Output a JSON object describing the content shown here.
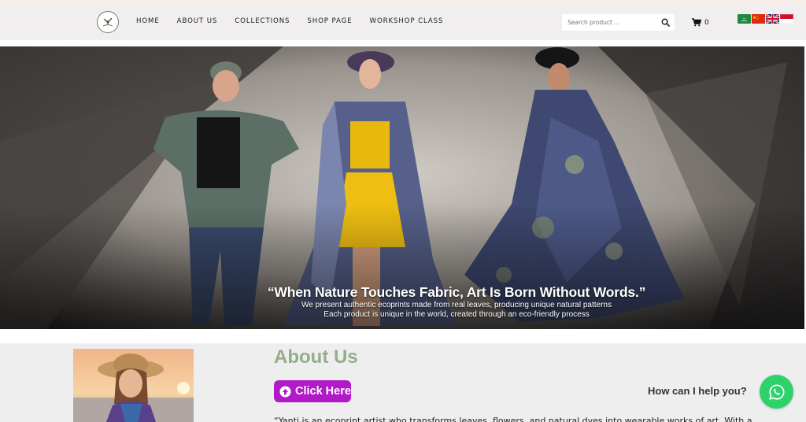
{
  "colors": {
    "nav_bg": "#f0eeee",
    "about_title": "#94ad8e",
    "button_bg": "#b219c8",
    "whatsapp": "#2dd36a"
  },
  "header": {
    "logo_icon": "brand-logo-icon",
    "nav": [
      "HOME",
      "ABOUT US",
      "COLLECTIONS",
      "SHOP PAGE",
      "WORKSHOP CLASS"
    ],
    "search_placeholder": "Search product ...",
    "search_icon": "search-icon",
    "cart_icon": "cart-icon",
    "cart_count": "0",
    "flags": [
      "arabic-flag-icon",
      "chinese-flag-icon",
      "uk-flag-icon",
      "indonesia-flag-icon"
    ]
  },
  "hero": {
    "headline": "“When Nature Touches Fabric, Art Is Born Without Words.”",
    "line1": "We present authentic ecoprints made from real leaves, producing unique natural patterns",
    "line2": "Each product is unique in the world, created through an eco-friendly process"
  },
  "about": {
    "title": "About Us",
    "button_label": "Click Here",
    "button_icon": "arrow-up-circle-icon",
    "help_text": "How can I help you?",
    "whatsapp_icon": "whatsapp-icon",
    "description": "“Yanti is an ecoprint artist who transforms leaves, flowers, and natural dyes into wearable works of art. With a"
  }
}
